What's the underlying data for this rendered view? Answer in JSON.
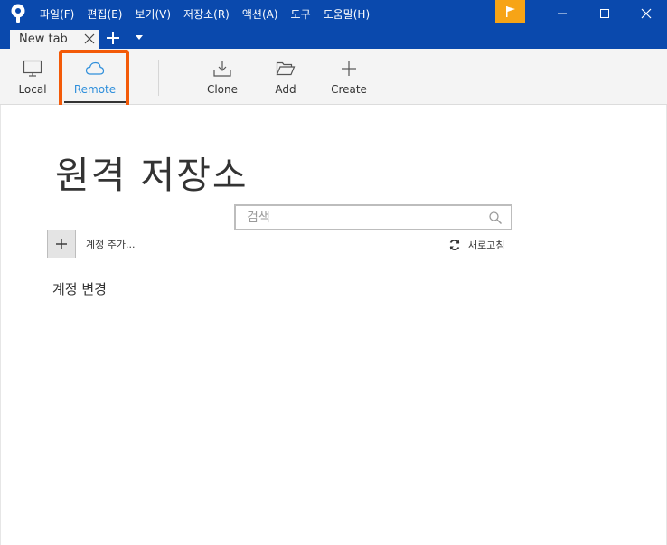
{
  "titlebar": {
    "menu": [
      "파일(F)",
      "편집(E)",
      "보기(V)",
      "저장소(R)",
      "액션(A)",
      "도구",
      "도움말(H)"
    ]
  },
  "tabs": {
    "items": [
      {
        "label": "New tab"
      }
    ]
  },
  "toolbar": {
    "local_label": "Local",
    "remote_label": "Remote",
    "clone_label": "Clone",
    "add_label": "Add",
    "create_label": "Create"
  },
  "main": {
    "title": "원격 저장소",
    "search_placeholder": "검색",
    "search_value": "",
    "add_account_label": "계정 추가...",
    "refresh_label": "새로고침",
    "change_account_label": "계정 변경"
  },
  "colors": {
    "titlebar": "#0a49ad",
    "flag": "#f7a416",
    "highlight": "#f35a08",
    "accent": "#2f8fdb"
  },
  "icons": {
    "app": "sourcetree-logo-icon",
    "flag": "flag-icon",
    "local": "monitor-icon",
    "remote": "cloud-icon",
    "clone": "download-icon",
    "add": "folder-open-icon",
    "create": "plus-icon",
    "search": "search-icon",
    "refresh": "refresh-icon"
  }
}
